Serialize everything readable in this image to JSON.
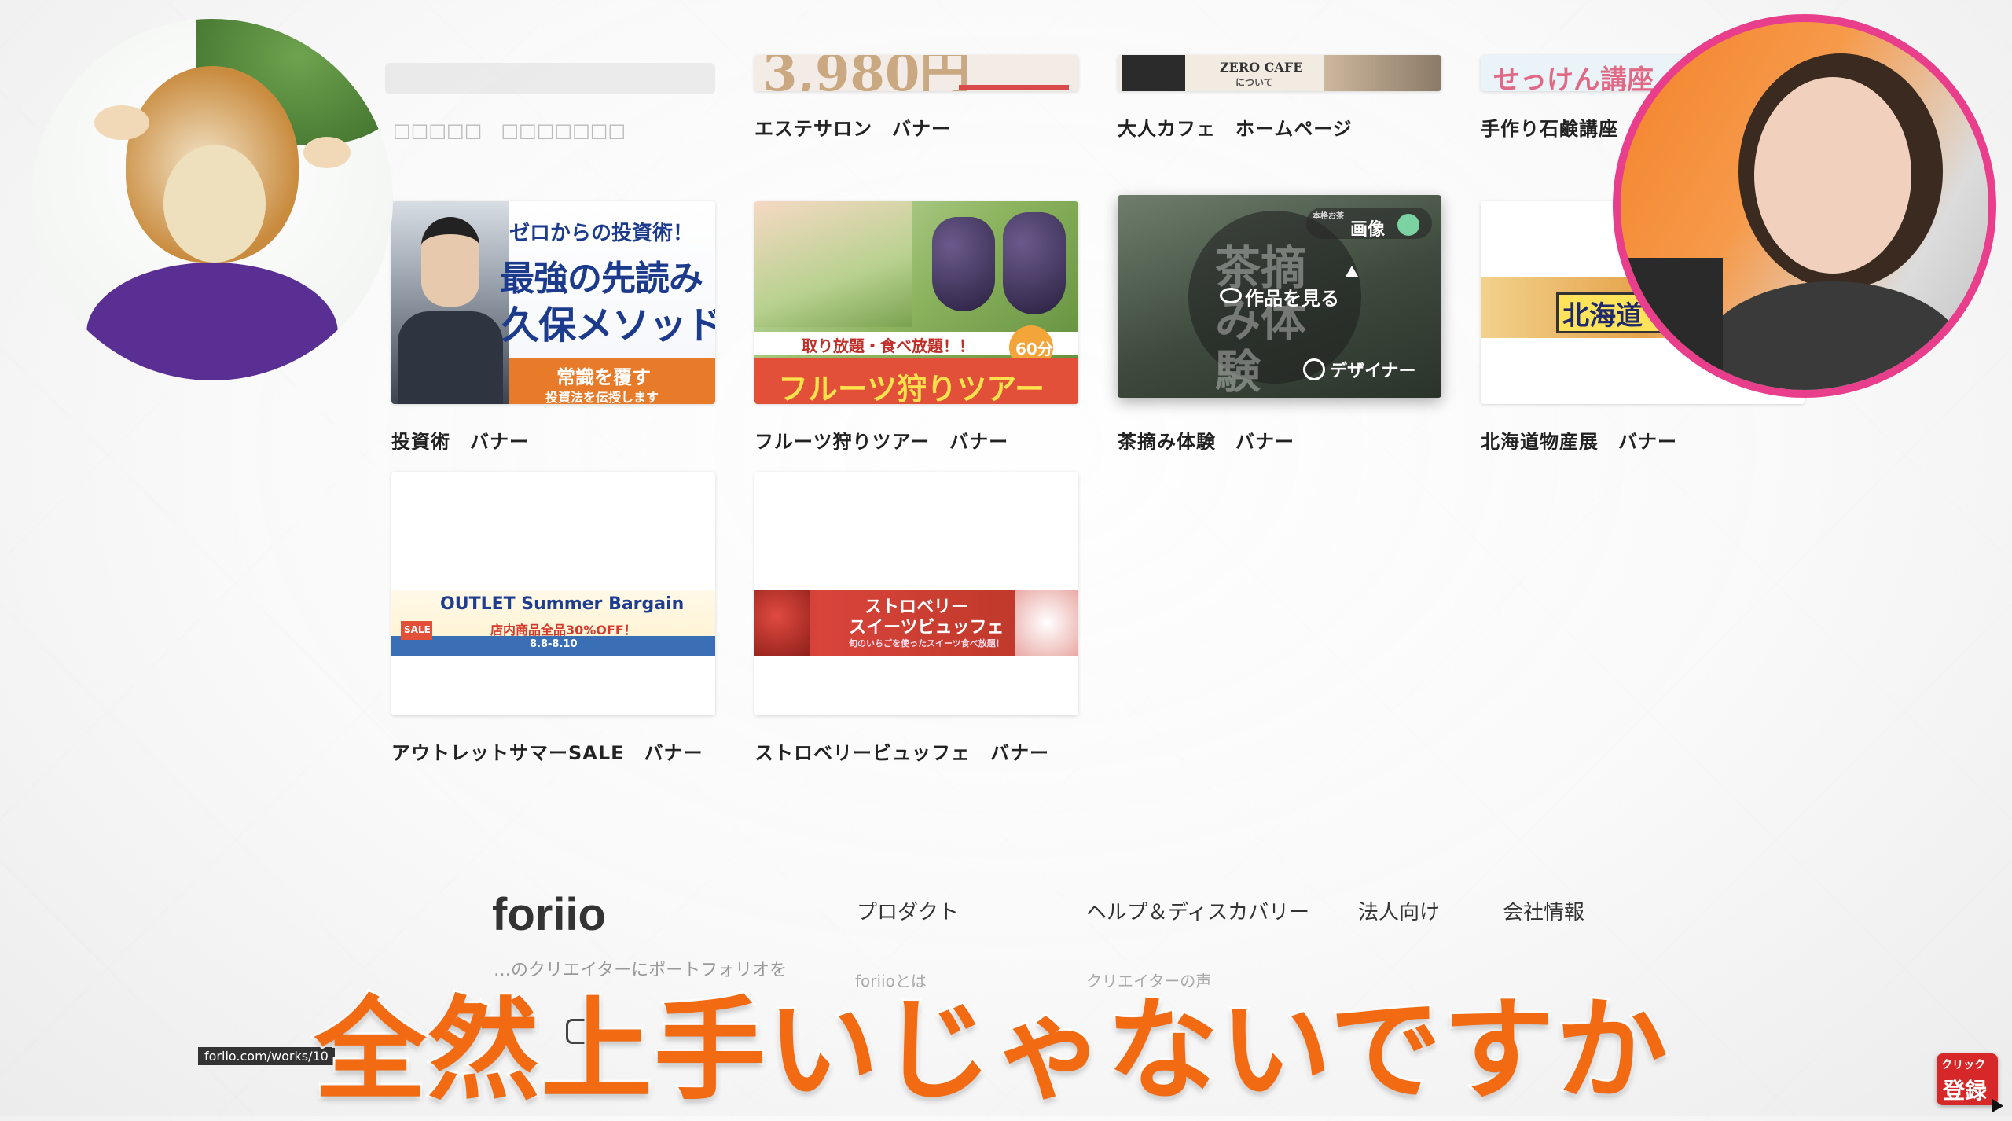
{
  "top_row": [
    {
      "caption": "エステサロン　バナー",
      "banner": "3,980円"
    },
    {
      "caption": "大人カフェ　ホームページ",
      "banner": "ZERO CAFE",
      "banner_sub": "について"
    },
    {
      "caption": "手作り石鹸講座",
      "banner": "せっけん講座"
    }
  ],
  "mid_row": [
    {
      "caption": "投資術　バナー",
      "line1": "ゼロからの投資術！",
      "line2": "最強の先読み",
      "line3": "久保メソッド",
      "line4": "常識を覆す",
      "line5": "投資法を伝授します"
    },
    {
      "caption": "フルーツ狩りツアー　バナー",
      "line1": "取り放題・食べ放題！！",
      "badge": "60分",
      "line2": "フルーツ狩りツアー"
    },
    {
      "caption": "茶摘み体験　バナー",
      "big": "茶摘み体験",
      "hover_view": "作品を見る",
      "hover_tag": "画像",
      "hover_designer": "デザイナー",
      "hover_small": "本格お茶"
    },
    {
      "caption": "北海道物産展　バナー",
      "banner": "北海道"
    }
  ],
  "bottom_row": [
    {
      "caption": "アウトレットサマーSALE　バナー",
      "line1": "OUTLET Summer Bargain",
      "line2": "店内商品全品30%OFF！",
      "line3": "8.8-8.10",
      "sale": "SALE"
    },
    {
      "caption": "ストロベリービュッフェ　バナー",
      "line1": "ストロベリー",
      "line2": "スイーツビュッフェ",
      "line3": "旬のいちごを使ったスイーツ食べ放題！"
    }
  ],
  "footer": {
    "logo": "foriio",
    "tagline": "…のクリエイターにポートフォリオを",
    "cols": [
      "プロダクト",
      "ヘルプ＆ディスカバリー",
      "法人向け",
      "会社情報"
    ],
    "ghost1": "foriioとは",
    "ghost2": "クリエイターの声"
  },
  "status_url": "foriio.com/works/10",
  "subtitle": "全然上手いじゃないですか",
  "subscribe": {
    "line1": "クリック",
    "line2": "登録"
  },
  "colors": {
    "accent": "#f26a12",
    "pink_ring": "#e83e8c",
    "subscribe_red": "#d62828"
  }
}
